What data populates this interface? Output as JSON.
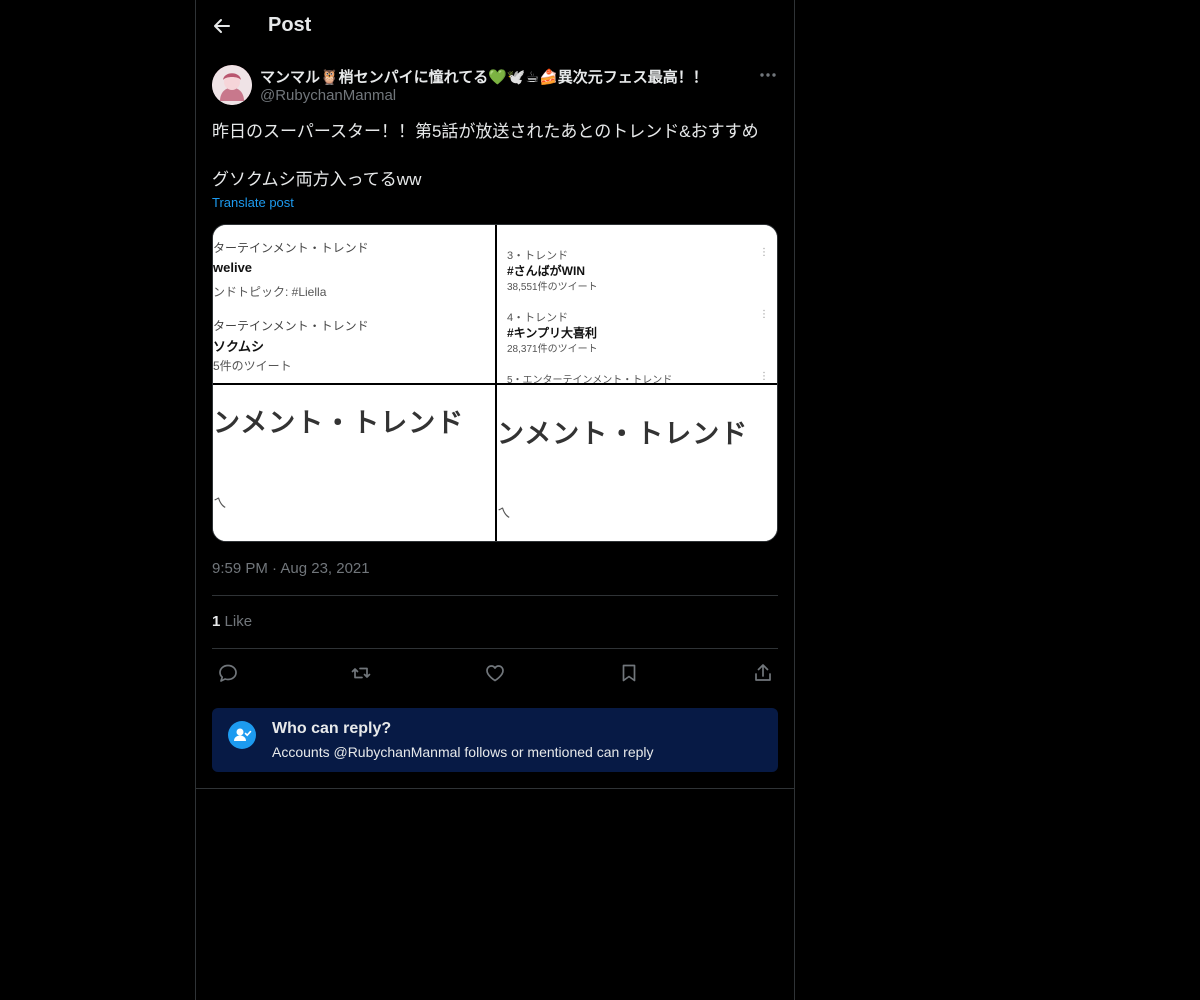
{
  "header": {
    "title": "Post",
    "back_icon": "arrow-left-icon"
  },
  "author": {
    "display_name": "マンマル🦉梢センパイに憧れてる💚🕊️☕🍰異次元フェス最高！！",
    "handle": "@RubychanManmal"
  },
  "post": {
    "text": "昨日のスーパースター！！第5話が放送されたあとのトレンド&おすすめ\n\nグソクムシ両方入ってるww",
    "translate_label": "Translate post",
    "timestamp": "9:59 PM · Aug 23, 2021"
  },
  "media": {
    "image1": {
      "line1": "ターテインメント・トレンド",
      "line2": "welive",
      "line3": "ンドトピック: #Liella",
      "line4": "ターテインメント・トレンド",
      "line5": "ソクムシ",
      "line6": "5件のツイート"
    },
    "image2": {
      "line1": "3・トレンド",
      "line2": "#さんばがWIN",
      "line3": "38,551件のツイート",
      "line4": "4・トレンド",
      "line5": "#キンプリ大喜利",
      "line6": "28,371件のツイート",
      "line7": "5・エンターテインメント・トレンド"
    },
    "image3": {
      "line1": "ンメント・トレンド"
    },
    "image4": {
      "line1": "ンメント・トレンド"
    }
  },
  "engagement": {
    "likes_count": "1",
    "likes_label": "Like"
  },
  "actions": [
    "reply-icon",
    "retweet-icon",
    "like-icon",
    "bookmark-icon",
    "share-icon"
  ],
  "reply_restriction": {
    "title": "Who can reply?",
    "description": "Accounts @RubychanManmal follows or mentioned can reply"
  },
  "colors": {
    "background": "#000000",
    "text": "#e7e9ea",
    "muted": "#71767b",
    "accent": "#1d9bf0",
    "reply_box": "#071a45"
  }
}
